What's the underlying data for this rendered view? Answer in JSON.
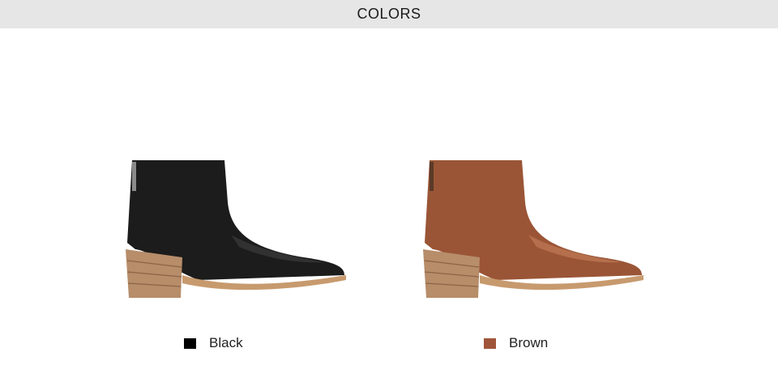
{
  "header": {
    "title": "COLORS"
  },
  "colors": [
    {
      "label": "Black",
      "swatch_color": "#000000",
      "leather_color": "#1c1c1c",
      "leather_highlight": "#3a3a3a"
    },
    {
      "label": "Brown",
      "swatch_color": "#a0553a",
      "leather_color": "#9a5536",
      "leather_highlight": "#c07a55"
    }
  ],
  "heel_color": "#b78d6a",
  "sole_color": "#c79a6e"
}
